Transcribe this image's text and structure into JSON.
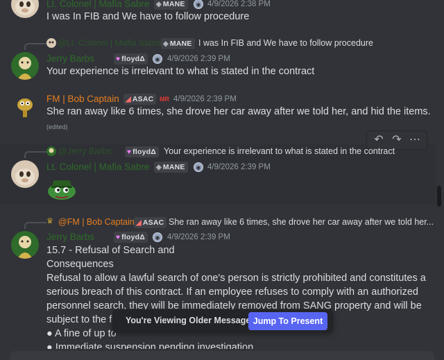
{
  "messages": [
    {
      "author": "Lt. Colonel | Mafia Sabre",
      "tag": "MANE",
      "tag_icon": "◈",
      "timestamp": "4/9/2026 2:38 PM",
      "text": "I was In FIB and We have to follow procedure"
    },
    {
      "reply": {
        "author": "@Lt. Colonel | Mafia Sabre",
        "tag": "MANE",
        "tag_icon": "◈",
        "text": "I was In FIB and We have to follow procedure"
      },
      "author": "Jerry Barbs",
      "tag": "floydΔ",
      "tag_icon": "♥",
      "timestamp": "4/9/2026 2:39 PM",
      "text": "Your experience is irrelevant to what is stated in the contract"
    },
    {
      "author": "FM | Bob Captain",
      "tag": "ASAC",
      "tag_icon": "◢",
      "extra_badge": "MR",
      "timestamp": "4/9/2026 2:39 PM",
      "text": "She ran away like 6 times, she drove her car away after we told her, and hid the items.",
      "edited": "(edited)"
    },
    {
      "reply": {
        "author": "@Jerry Barbs",
        "tag": "floydΔ",
        "tag_icon": "♥",
        "text": "Your experience is irrelevant to what is stated in the contract"
      },
      "author": "Lt. Colonel | Mafia Sabre",
      "tag": "MANE",
      "tag_icon": "◈",
      "timestamp": "4/9/2026 2:39 PM"
    },
    {
      "reply": {
        "author": "@FM | Bob Captain",
        "tag": "ASAC",
        "tag_icon": "◢",
        "text": "She ran away like 6 times, she drove her car away after we told her..."
      },
      "author": "Jerry Barbs",
      "tag": "floydΔ",
      "tag_icon": "♥",
      "timestamp": "4/9/2026 2:39 PM",
      "lines": [
        "15.7 - Refusal of Search and",
        "Consequences",
        "Refusal to allow a lawful search of one's person is strictly prohibited and constitutes a",
        "serious breach of this contract. If an employee refuses to comply with an authorized",
        "personnel search, they will be immediately removed from SANG property and will be",
        "subject to the fo",
        "● A fine of up to",
        "● Immediate suspension pending investigation"
      ]
    }
  ],
  "toolbar": {
    "reply_icon": "↶",
    "forward_icon": "↷",
    "more_icon": "⋯"
  },
  "banner": {
    "text": "You're Viewing Older Messages",
    "button": "Jump To Present"
  },
  "colors": {
    "accent": "#5865f2",
    "background": "#313338",
    "green_name": "#2f6b2a",
    "orange_name": "#e67e22"
  }
}
